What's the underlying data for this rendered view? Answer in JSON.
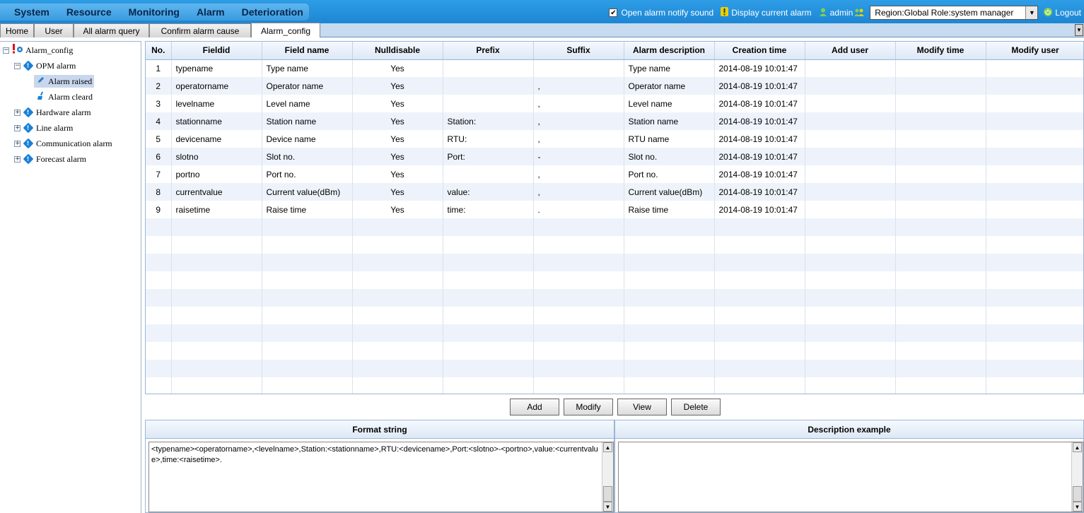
{
  "menu": [
    "System",
    "Resource",
    "Monitoring",
    "Alarm",
    "Deterioration"
  ],
  "topright": {
    "notify_label": "Open alarm notify sound",
    "notify_checked": true,
    "display_current": "Display current alarm",
    "user": "admin",
    "region": "Region:Global Role:system manager",
    "logout": "Logout"
  },
  "tabs": [
    "Home",
    "User",
    "All alarm query",
    "Confirm alarm cause",
    "Alarm_config"
  ],
  "active_tab": "Alarm_config",
  "tree": {
    "root": "Alarm_config",
    "opm": "OPM alarm",
    "alarm_raised": "Alarm raised",
    "alarm_cleard": "Alarm cleard",
    "hardware": "Hardware alarm",
    "line": "Line alarm",
    "communication": "Communication alarm",
    "forecast": "Forecast alarm"
  },
  "grid": {
    "columns": [
      "No.",
      "Fieldid",
      "Field name",
      "Nulldisable",
      "Prefix",
      "Suffix",
      "Alarm description",
      "Creation time",
      "Add user",
      "Modify time",
      "Modify user"
    ],
    "rows": [
      [
        "1",
        "typename",
        "Type name",
        "Yes",
        "",
        "",
        "Type name",
        "2014-08-19 10:01:47",
        "",
        "",
        ""
      ],
      [
        "2",
        "operatorname",
        "Operator name",
        "Yes",
        "",
        ",",
        "Operator name",
        "2014-08-19 10:01:47",
        "",
        "",
        ""
      ],
      [
        "3",
        "levelname",
        "Level name",
        "Yes",
        "",
        ",",
        "Level name",
        "2014-08-19 10:01:47",
        "",
        "",
        ""
      ],
      [
        "4",
        "stationname",
        "Station name",
        "Yes",
        "Station:",
        ",",
        "Station name",
        "2014-08-19 10:01:47",
        "",
        "",
        ""
      ],
      [
        "5",
        "devicename",
        "Device name",
        "Yes",
        "RTU:",
        ",",
        "RTU name",
        "2014-08-19 10:01:47",
        "",
        "",
        ""
      ],
      [
        "6",
        "slotno",
        "Slot no.",
        "Yes",
        "Port:",
        "-",
        "Slot no.",
        "2014-08-19 10:01:47",
        "",
        "",
        ""
      ],
      [
        "7",
        "portno",
        "Port no.",
        "Yes",
        "",
        ",",
        "Port no.",
        "2014-08-19 10:01:47",
        "",
        "",
        ""
      ],
      [
        "8",
        "currentvalue",
        "Current value(dBm)",
        "Yes",
        "value:",
        ",",
        "Current value(dBm)",
        "2014-08-19 10:01:47",
        "",
        "",
        ""
      ],
      [
        "9",
        "raisetime",
        "Raise time",
        "Yes",
        "time:",
        ".",
        "Raise time",
        "2014-08-19 10:01:47",
        "",
        "",
        ""
      ]
    ]
  },
  "buttons": {
    "add": "Add",
    "modify": "Modify",
    "view": "View",
    "delete": "Delete"
  },
  "format_panel": {
    "title": "Format string",
    "value": "<typename><operatorname>,<levelname>,Station:<stationname>,RTU:<devicename>,Port:<slotno>-<portno>,value:<currentvalue>,time:<raisetime>."
  },
  "example_panel": {
    "title": "Description example",
    "value": ""
  },
  "colors": {
    "topbar": "#1d86d4",
    "menu_text": "#08264a",
    "grid_alt_row": "#eef3fb",
    "selected_node": "#c9d7ee"
  }
}
